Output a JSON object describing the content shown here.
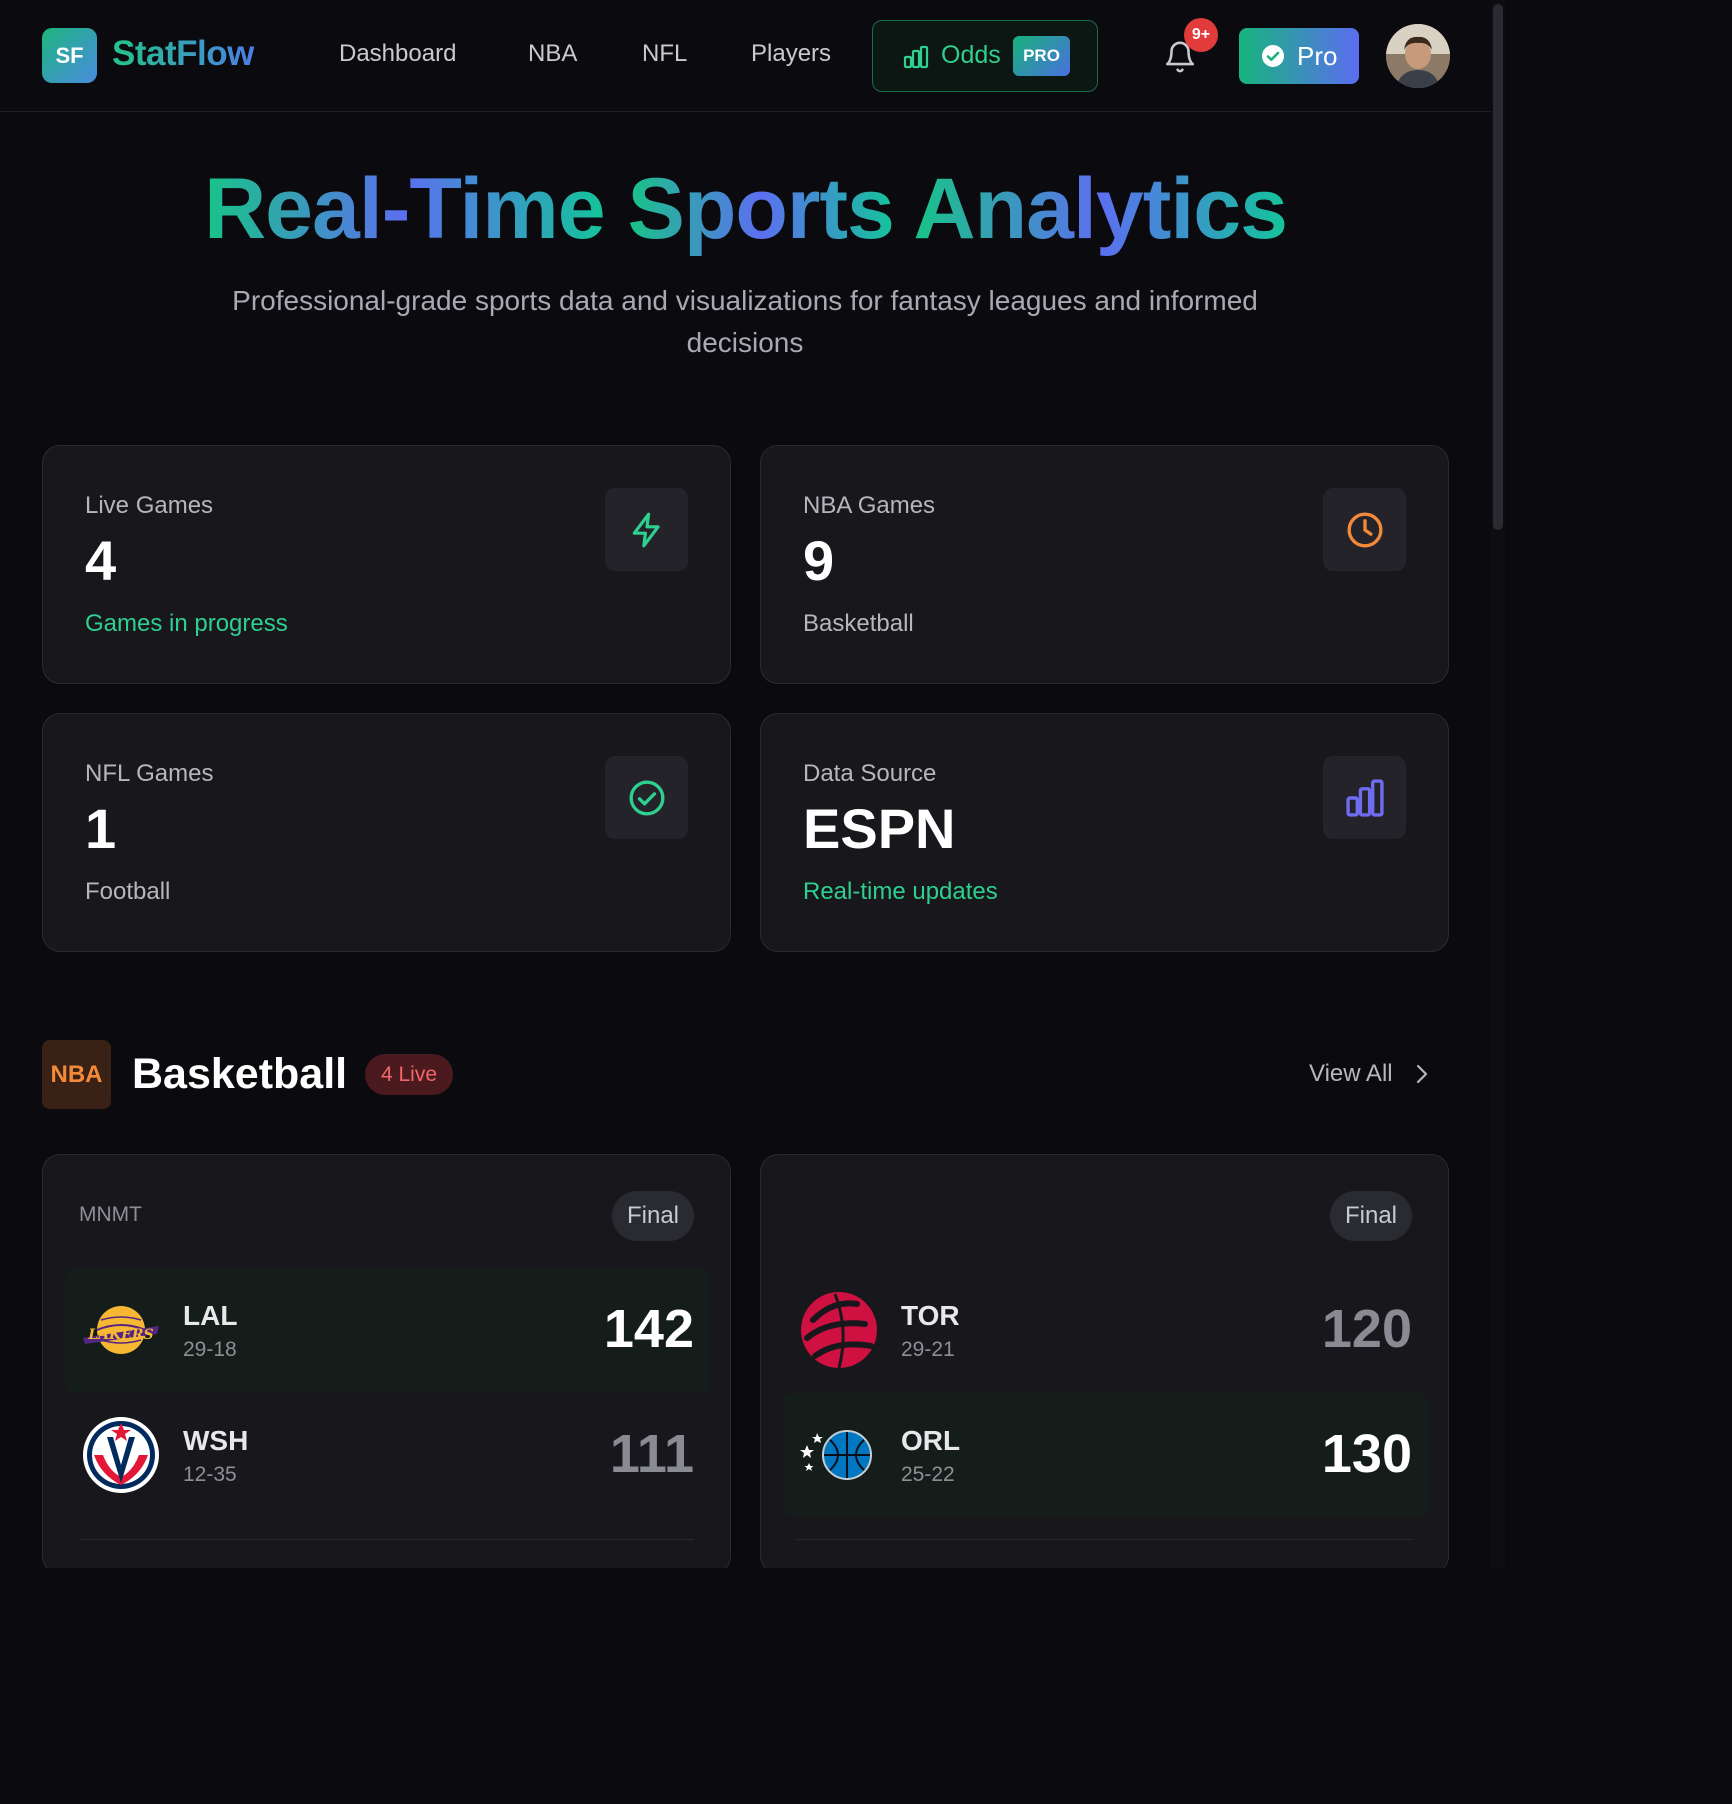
{
  "app": {
    "logo_initials": "SF",
    "name": "StatFlow"
  },
  "nav": {
    "items": [
      "Dashboard",
      "NBA",
      "NFL",
      "Players"
    ],
    "odds_label": "Odds",
    "odds_badge": "PRO"
  },
  "notifications": {
    "badge": "9+"
  },
  "pro_button": {
    "label": "Pro"
  },
  "hero": {
    "title_words": [
      "Real-Time",
      "Sports",
      "Analytics"
    ],
    "subtitle": "Professional-grade sports data and visualizations for fantasy leagues and informed decisions"
  },
  "stats": [
    {
      "label": "Live Games",
      "value": "4",
      "sub": "Games in progress",
      "icon": "bolt-icon",
      "color": "#2fcf8f"
    },
    {
      "label": "NBA Games",
      "value": "9",
      "sub": "Basketball",
      "icon": "clock-icon",
      "color": "#f28a3a"
    },
    {
      "label": "NFL Games",
      "value": "1",
      "sub": "Football",
      "icon": "check-circle-icon",
      "color": "#2fcf8f"
    },
    {
      "label": "Data Source",
      "value": "ESPN",
      "sub": "Real-time updates",
      "icon": "bar-chart-icon",
      "color": "#6f6cf0"
    }
  ],
  "section": {
    "badge": "NBA",
    "title": "Basketball",
    "live_pill": "4 Live",
    "view_all": "View All"
  },
  "games": [
    {
      "league": "MNMT",
      "status": "Final",
      "teams": [
        {
          "abbr": "LAL",
          "record": "29-18",
          "score": "142",
          "winner": true,
          "logo": "lakers-logo"
        },
        {
          "abbr": "WSH",
          "record": "12-35",
          "score": "111",
          "winner": false,
          "logo": "wizards-logo"
        }
      ]
    },
    {
      "league": "",
      "status": "Final",
      "teams": [
        {
          "abbr": "TOR",
          "record": "29-21",
          "score": "120",
          "winner": false,
          "logo": "raptors-logo"
        },
        {
          "abbr": "ORL",
          "record": "25-22",
          "score": "130",
          "winner": true,
          "logo": "magic-logo"
        }
      ]
    }
  ],
  "colors": {
    "accent_green": "#2fcf8f",
    "accent_blue": "#5c6ff0",
    "live_red": "#f06767",
    "nba_orange": "#f28a3a"
  }
}
